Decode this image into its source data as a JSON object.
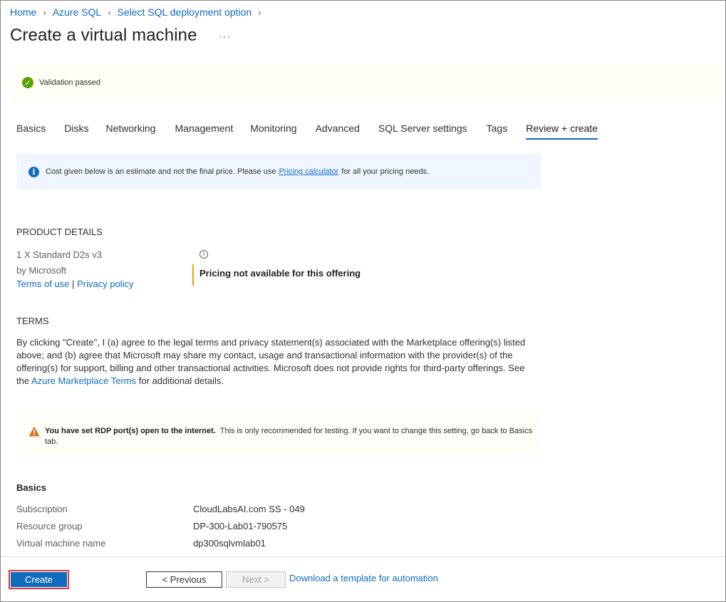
{
  "breadcrumb": {
    "items": [
      "Home",
      "Azure SQL",
      "Select SQL deployment option"
    ]
  },
  "page": {
    "title": "Create a virtual machine",
    "more": "···"
  },
  "validation": {
    "text": "Validation passed"
  },
  "tabs": [
    {
      "label": "Basics"
    },
    {
      "label": "Disks"
    },
    {
      "label": "Networking"
    },
    {
      "label": "Management"
    },
    {
      "label": "Monitoring"
    },
    {
      "label": "Advanced"
    },
    {
      "label": "SQL Server settings"
    },
    {
      "label": "Tags"
    },
    {
      "label": "Review + create"
    }
  ],
  "active_tab": "Review + create",
  "info": {
    "before": "Cost given below is an estimate and not the final price. Please use",
    "link": "Pricing calculator",
    "after": "for all your pricing needs."
  },
  "product": {
    "heading": "PRODUCT DETAILS",
    "name": "1 X Standard D2s v3",
    "publisher": "by Microsoft",
    "terms_link": "Terms of use",
    "divider": "|",
    "privacy_link": "Privacy policy",
    "pricing": "Pricing not available for this offering"
  },
  "terms": {
    "heading": "TERMS",
    "before": "By clicking \"Create\", I (a) agree to the legal terms and privacy statement(s) associated with the Marketplace offering(s) listed above; and (b) agree that Microsoft may share my contact, usage and transactional information with the provider(s) of the offering(s) for support, billing and other transactional activities. Microsoft does not provide rights for third-party offerings. See the",
    "link": "Azure Marketplace Terms",
    "after": "for additional details."
  },
  "warning": {
    "bold": "You have set RDP port(s) open to the internet.",
    "rest": "This is only recommended for testing.  If you want to change this setting, go back to Basics tab."
  },
  "basics": {
    "heading": "Basics",
    "rows": [
      {
        "label": "Subscription",
        "value": "CloudLabsAI.com SS - 049"
      },
      {
        "label": "Resource group",
        "value": "DP-300-Lab01-790575"
      },
      {
        "label": "Virtual machine name",
        "value": "dp300sqlvmlab01"
      }
    ]
  },
  "footer": {
    "create": "Create",
    "previous": "< Previous",
    "next": "Next >",
    "download": "Download a template for automation"
  },
  "colors": {
    "accent": "#0f6cbd",
    "success": "#57a300",
    "warning": "#f2a100",
    "highlight": "#e03a3a"
  }
}
